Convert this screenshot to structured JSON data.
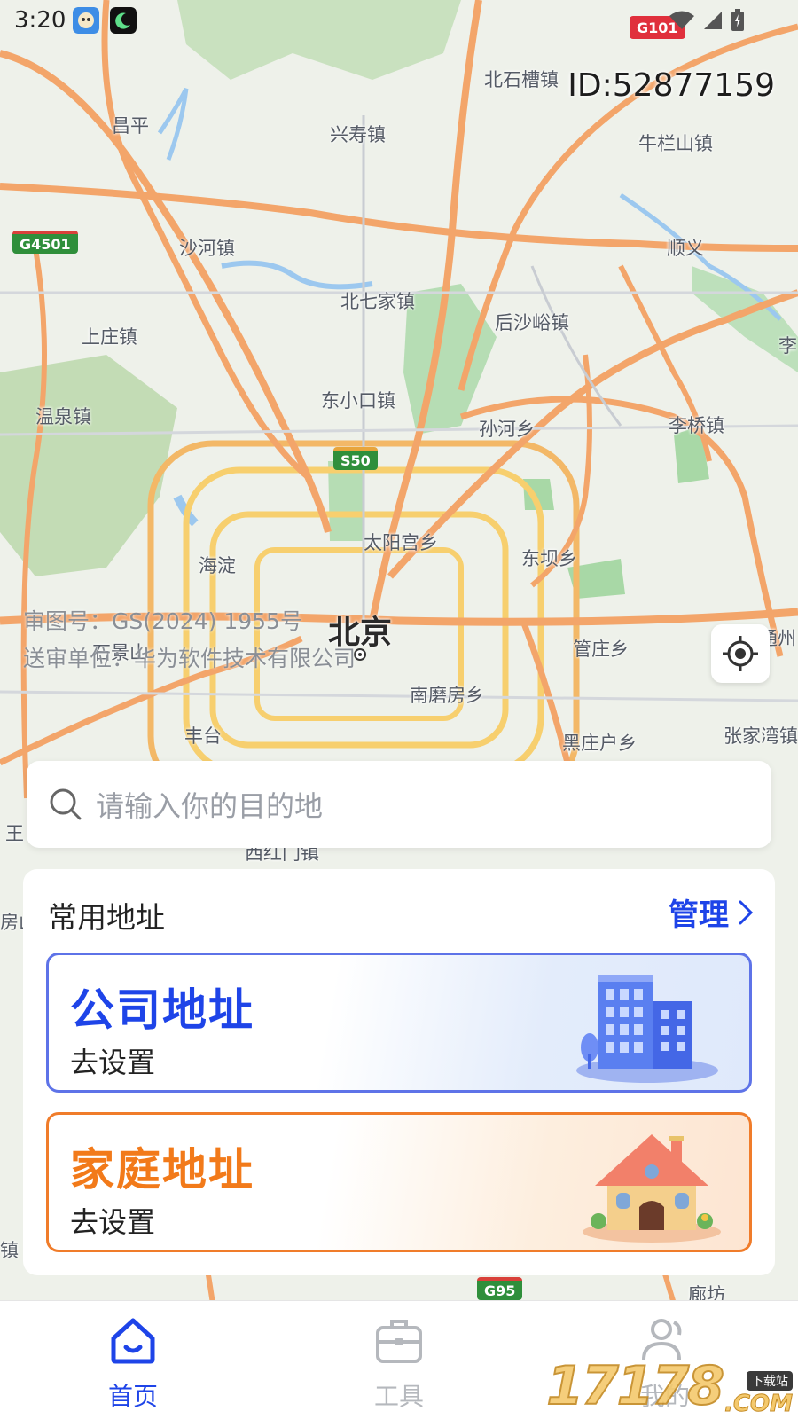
{
  "status_bar": {
    "time": "3:20",
    "icons": [
      "avatar-app-icon",
      "moon-app-icon",
      "wifi-icon",
      "signal-icon",
      "battery-icon"
    ]
  },
  "map": {
    "user_id": "ID:52877159",
    "city_label": "北京",
    "place_labels": [
      {
        "name": "place-beishicaozhen",
        "text": "北石槽镇"
      },
      {
        "name": "place-changping",
        "text": "昌平"
      },
      {
        "name": "place-xingshouzhen",
        "text": "兴寿镇"
      },
      {
        "name": "place-niulanshanzhen",
        "text": "牛栏山镇"
      },
      {
        "name": "place-shahezhen",
        "text": "沙河镇"
      },
      {
        "name": "place-shunyi",
        "text": "顺义"
      },
      {
        "name": "place-beiqijiazhen",
        "text": "北七家镇"
      },
      {
        "name": "place-houshayuzhen",
        "text": "后沙峪镇"
      },
      {
        "name": "place-shangzhuangzhen",
        "text": "上庄镇"
      },
      {
        "name": "place-li",
        "text": "李"
      },
      {
        "name": "place-dongxiaokouzhen",
        "text": "东小口镇"
      },
      {
        "name": "place-wenquanzhen",
        "text": "温泉镇"
      },
      {
        "name": "place-sunhexiang",
        "text": "孙河乡"
      },
      {
        "name": "place-liqiaozhen",
        "text": "李桥镇"
      },
      {
        "name": "place-taiyanggongxiang",
        "text": "太阳宫乡"
      },
      {
        "name": "place-dongbaxiang",
        "text": "东坝乡"
      },
      {
        "name": "place-haidian",
        "text": "海淀"
      },
      {
        "name": "place-tongzhou",
        "text": "通州"
      },
      {
        "name": "place-shijingshan",
        "text": "石景山"
      },
      {
        "name": "place-guanzhuangxiang",
        "text": "管庄乡"
      },
      {
        "name": "place-nanmofangxiang",
        "text": "南磨房乡"
      },
      {
        "name": "place-fengtai",
        "text": "丰台"
      },
      {
        "name": "place-heizhuanghuxiang",
        "text": "黑庄户乡"
      },
      {
        "name": "place-zhangjiawan",
        "text": "张家湾镇"
      },
      {
        "name": "place-wang",
        "text": "王"
      },
      {
        "name": "place-xihongmenzhen",
        "text": "西红门镇"
      },
      {
        "name": "place-fang",
        "text": "房山"
      },
      {
        "name": "place-zhen",
        "text": "镇"
      },
      {
        "name": "place-langfang",
        "text": "廊坊"
      }
    ],
    "road_shields": [
      {
        "name": "shield-g101",
        "text": "G101"
      },
      {
        "name": "shield-g4501",
        "text": "G4501"
      },
      {
        "name": "shield-s50",
        "text": "S50"
      },
      {
        "name": "shield-g95",
        "text": "G95"
      }
    ],
    "approval_line1": "审图号：GS(2024) 1955号",
    "approval_line2": "送审单位：华为软件技术有限公司"
  },
  "search": {
    "placeholder": "请输入你的目的地"
  },
  "common_addresses": {
    "title": "常用地址",
    "manage_label": "管理",
    "company": {
      "title": "公司地址",
      "subtitle": "去设置"
    },
    "home": {
      "title": "家庭地址",
      "subtitle": "去设置"
    }
  },
  "bottom_nav": {
    "items": [
      {
        "label": "首页",
        "icon": "home-icon",
        "active": true
      },
      {
        "label": "工具",
        "icon": "briefcase-icon",
        "active": false
      },
      {
        "label": "我的",
        "icon": "user-icon",
        "active": false
      }
    ]
  },
  "watermark": {
    "digits": "17178",
    "tag": "下载站",
    "suffix": ".COM"
  },
  "colors": {
    "accent_blue": "#1e44e8",
    "accent_orange": "#f27a1a",
    "road_orange": "#f3a56a",
    "road_yellow": "#f7cf6e",
    "park_green": "#a8d8a6"
  }
}
